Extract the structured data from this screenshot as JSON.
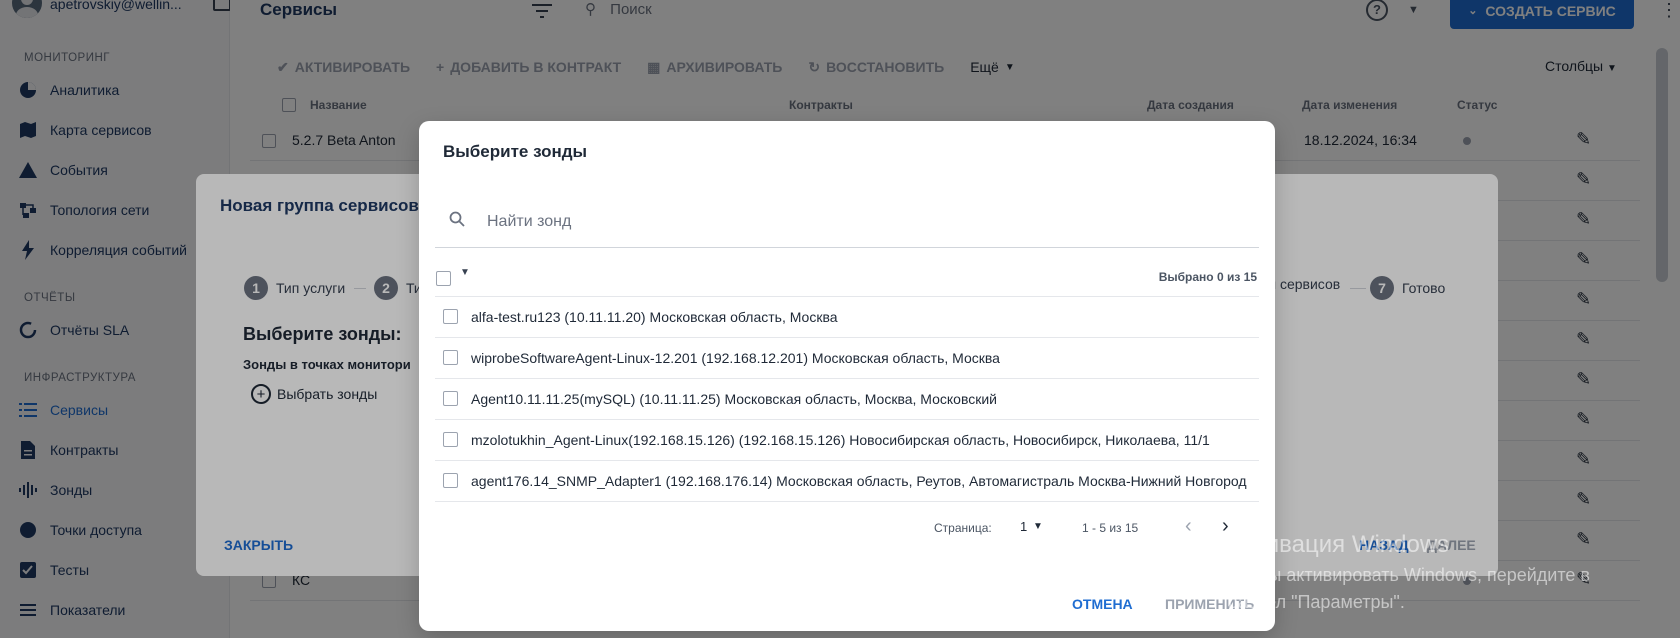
{
  "user": {
    "email": "apetrovskiy@wellin..."
  },
  "sidebar": {
    "sections": [
      {
        "title": "МОНИТОРИНГ",
        "items": [
          {
            "label": "Аналитика",
            "icon": "pie-chart-icon"
          },
          {
            "label": "Карта сервисов",
            "icon": "map-icon"
          },
          {
            "label": "События",
            "icon": "warning-icon"
          },
          {
            "label": "Топология сети",
            "icon": "topology-icon"
          },
          {
            "label": "Корреляция событий",
            "icon": "bolt-icon"
          }
        ]
      },
      {
        "title": "ОТЧЁТЫ",
        "items": [
          {
            "label": "Отчёты SLA",
            "icon": "refresh-icon"
          }
        ]
      },
      {
        "title": "ИНФРАСТРУКТУРА",
        "items": [
          {
            "label": "Сервисы",
            "icon": "list-icon",
            "active": true
          },
          {
            "label": "Контракты",
            "icon": "document-icon"
          },
          {
            "label": "Зонды",
            "icon": "sound-wave-icon"
          },
          {
            "label": "Точки доступа",
            "icon": "circle-icon"
          },
          {
            "label": "Тесты",
            "icon": "test-icon"
          },
          {
            "label": "Показатели",
            "icon": "equalizer-icon"
          }
        ]
      }
    ]
  },
  "topbar": {
    "title": "Сервисы",
    "search_placeholder": "Поиск",
    "create_label": "СОЗДАТЬ СЕРВИС",
    "help": "?"
  },
  "toolbar": {
    "activate": "АКТИВИРОВАТЬ",
    "add_contract": "ДОБАВИТЬ В КОНТРАКТ",
    "archive": "АРХИВИРОВАТЬ",
    "restore": "ВОССТАНОВИТЬ",
    "more": "Ещё",
    "columns": "Столбцы"
  },
  "grid": {
    "headers": {
      "name": "Название",
      "contracts": "Контракты",
      "created": "Дата создания",
      "changed": "Дата изменения",
      "status": "Статус"
    },
    "rows": [
      {
        "name": "5.2.7 Beta Anton",
        "changed": "18.12.2024, 16:34"
      },
      {
        "name": "",
        "changed": ""
      },
      {
        "name": "",
        "changed": ""
      },
      {
        "name": "",
        "changed": ""
      },
      {
        "name": "",
        "changed": ""
      },
      {
        "name": "",
        "changed": ""
      },
      {
        "name": "",
        "changed": ""
      },
      {
        "name": "",
        "changed": ""
      },
      {
        "name": "",
        "changed": ""
      },
      {
        "name": "",
        "changed": ""
      },
      {
        "name": "",
        "changed": ""
      },
      {
        "name": "КС",
        "changed": ""
      }
    ]
  },
  "wizard": {
    "title": "Новая группа сервисов",
    "steps": [
      {
        "num": "1",
        "label": "Тип услуги"
      },
      {
        "num": "2",
        "label": "Ти"
      },
      {
        "num": "",
        "label": "ы сервисов"
      },
      {
        "num": "7",
        "label": "Готово"
      }
    ],
    "heading": "Выберите зонды:",
    "subheading": "Зонды в точках монитори",
    "choose_label": "Выбрать зонды",
    "close_label": "ЗАКРЫТЬ",
    "back_label": "НАЗАД",
    "next_label": "ДАЛЕЕ"
  },
  "modal": {
    "title": "Выберите зонды",
    "search_placeholder": "Найти зонд",
    "selected_text": "Выбрано 0 из 15",
    "items": [
      "alfa-test.ru123 (10.11.11.20) Московская область, Москва",
      "wiprobeSoftwareAgent-Linux-12.201 (192.168.12.201) Московская область, Москва",
      "Agent10.11.11.25(mySQL) (10.11.11.25) Московская область, Москва, Московский",
      "mzolotukhin_Agent-Linux(192.168.15.126) (192.168.15.126) Новосибирская область, Новосибирск, Николаева, 11/1",
      "agent176.14_SNMP_Adapter1 (192.168.176.14) Московская область, Реутов, Автомагистраль Москва-Нижний Новгород"
    ],
    "pager": {
      "label": "Страница:",
      "page": "1",
      "range": "1 - 5 из 15"
    },
    "cancel_label": "ОТМЕНА",
    "apply_label": "ПРИМЕНИТЬ"
  },
  "watermark": {
    "title": "Активация Windows",
    "line1": "Чтобы активировать Windows, перейдите в",
    "line2": "раздел \"Параметры\"."
  },
  "colors": {
    "accent": "#1f6dd1",
    "text": "#1f3a64",
    "disabled": "#9ca3af"
  }
}
